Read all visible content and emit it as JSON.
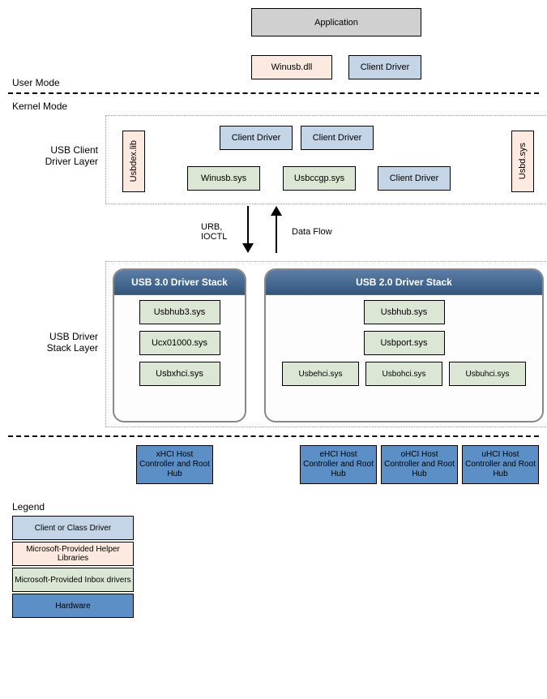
{
  "labels": {
    "user_mode": "User Mode",
    "kernel_mode": "Kernel Mode",
    "client_layer": "USB Client Driver Layer",
    "stack_layer": "USB Driver Stack Layer",
    "urb": "URB, IOCTL",
    "data_flow": "Data Flow",
    "legend_title": "Legend"
  },
  "top": {
    "application": "Application",
    "winusb_dll": "Winusb.dll",
    "client_driver": "Client Driver"
  },
  "client_layer": {
    "usbdexlib": "Usbdex.lib",
    "client_driver": "Client Driver",
    "winusb_sys": "Winusb.sys",
    "usbccgp_sys": "Usbccgp.sys",
    "usbd_sys": "Usbd.sys"
  },
  "stack3": {
    "title": "USB 3.0 Driver Stack",
    "items": [
      "Usbhub3.sys",
      "Ucx01000.sys",
      "Usbxhci.sys"
    ]
  },
  "stack2": {
    "title": "USB 2.0 Driver Stack",
    "top_items": [
      "Usbhub.sys",
      "Usbport.sys"
    ],
    "bottom_items": [
      "Usbehci.sys",
      "Usbohci.sys",
      "Usbuhci.sys"
    ]
  },
  "hardware": {
    "xhci": "xHCI Host Controller and Root Hub",
    "ehci": "eHCI Host Controller and Root Hub",
    "ohci": "oHCI Host Controller and Root Hub",
    "uhci": "uHCI Host Controller and Root Hub"
  },
  "legend": {
    "client_class": "Client or Class Driver",
    "helper": "Microsoft-Provided Helper Libraries",
    "inbox": "Microsoft-Provided Inbox drivers",
    "hardware": "Hardware"
  }
}
